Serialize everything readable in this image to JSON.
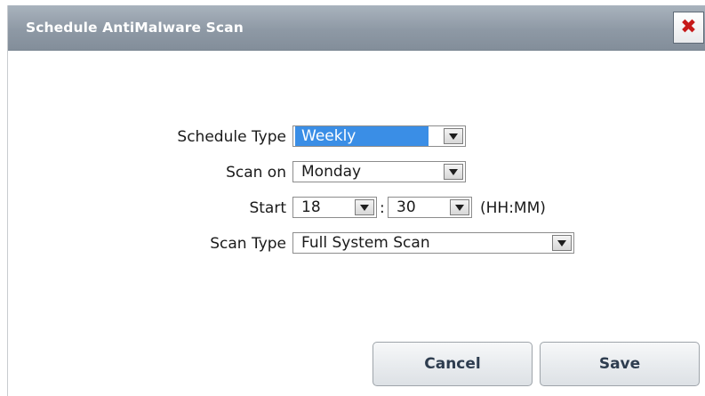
{
  "dialog": {
    "title": "Schedule AntiMalware Scan",
    "close_glyph": "✖"
  },
  "form": {
    "schedule_type": {
      "label": "Schedule Type",
      "value": "Weekly"
    },
    "scan_on": {
      "label": "Scan on",
      "value": "Monday"
    },
    "start": {
      "label": "Start",
      "hour": "18",
      "separator": ":",
      "minute": "30",
      "format_hint": "(HH:MM)"
    },
    "scan_type": {
      "label": "Scan Type",
      "value": "Full System Scan"
    }
  },
  "buttons": {
    "cancel": "Cancel",
    "save": "Save"
  },
  "colors": {
    "title_bar": "#8e99a5",
    "selection_highlight": "#3a8ee6",
    "close_x": "#c61a1a",
    "button_text": "#2e3d4f"
  }
}
